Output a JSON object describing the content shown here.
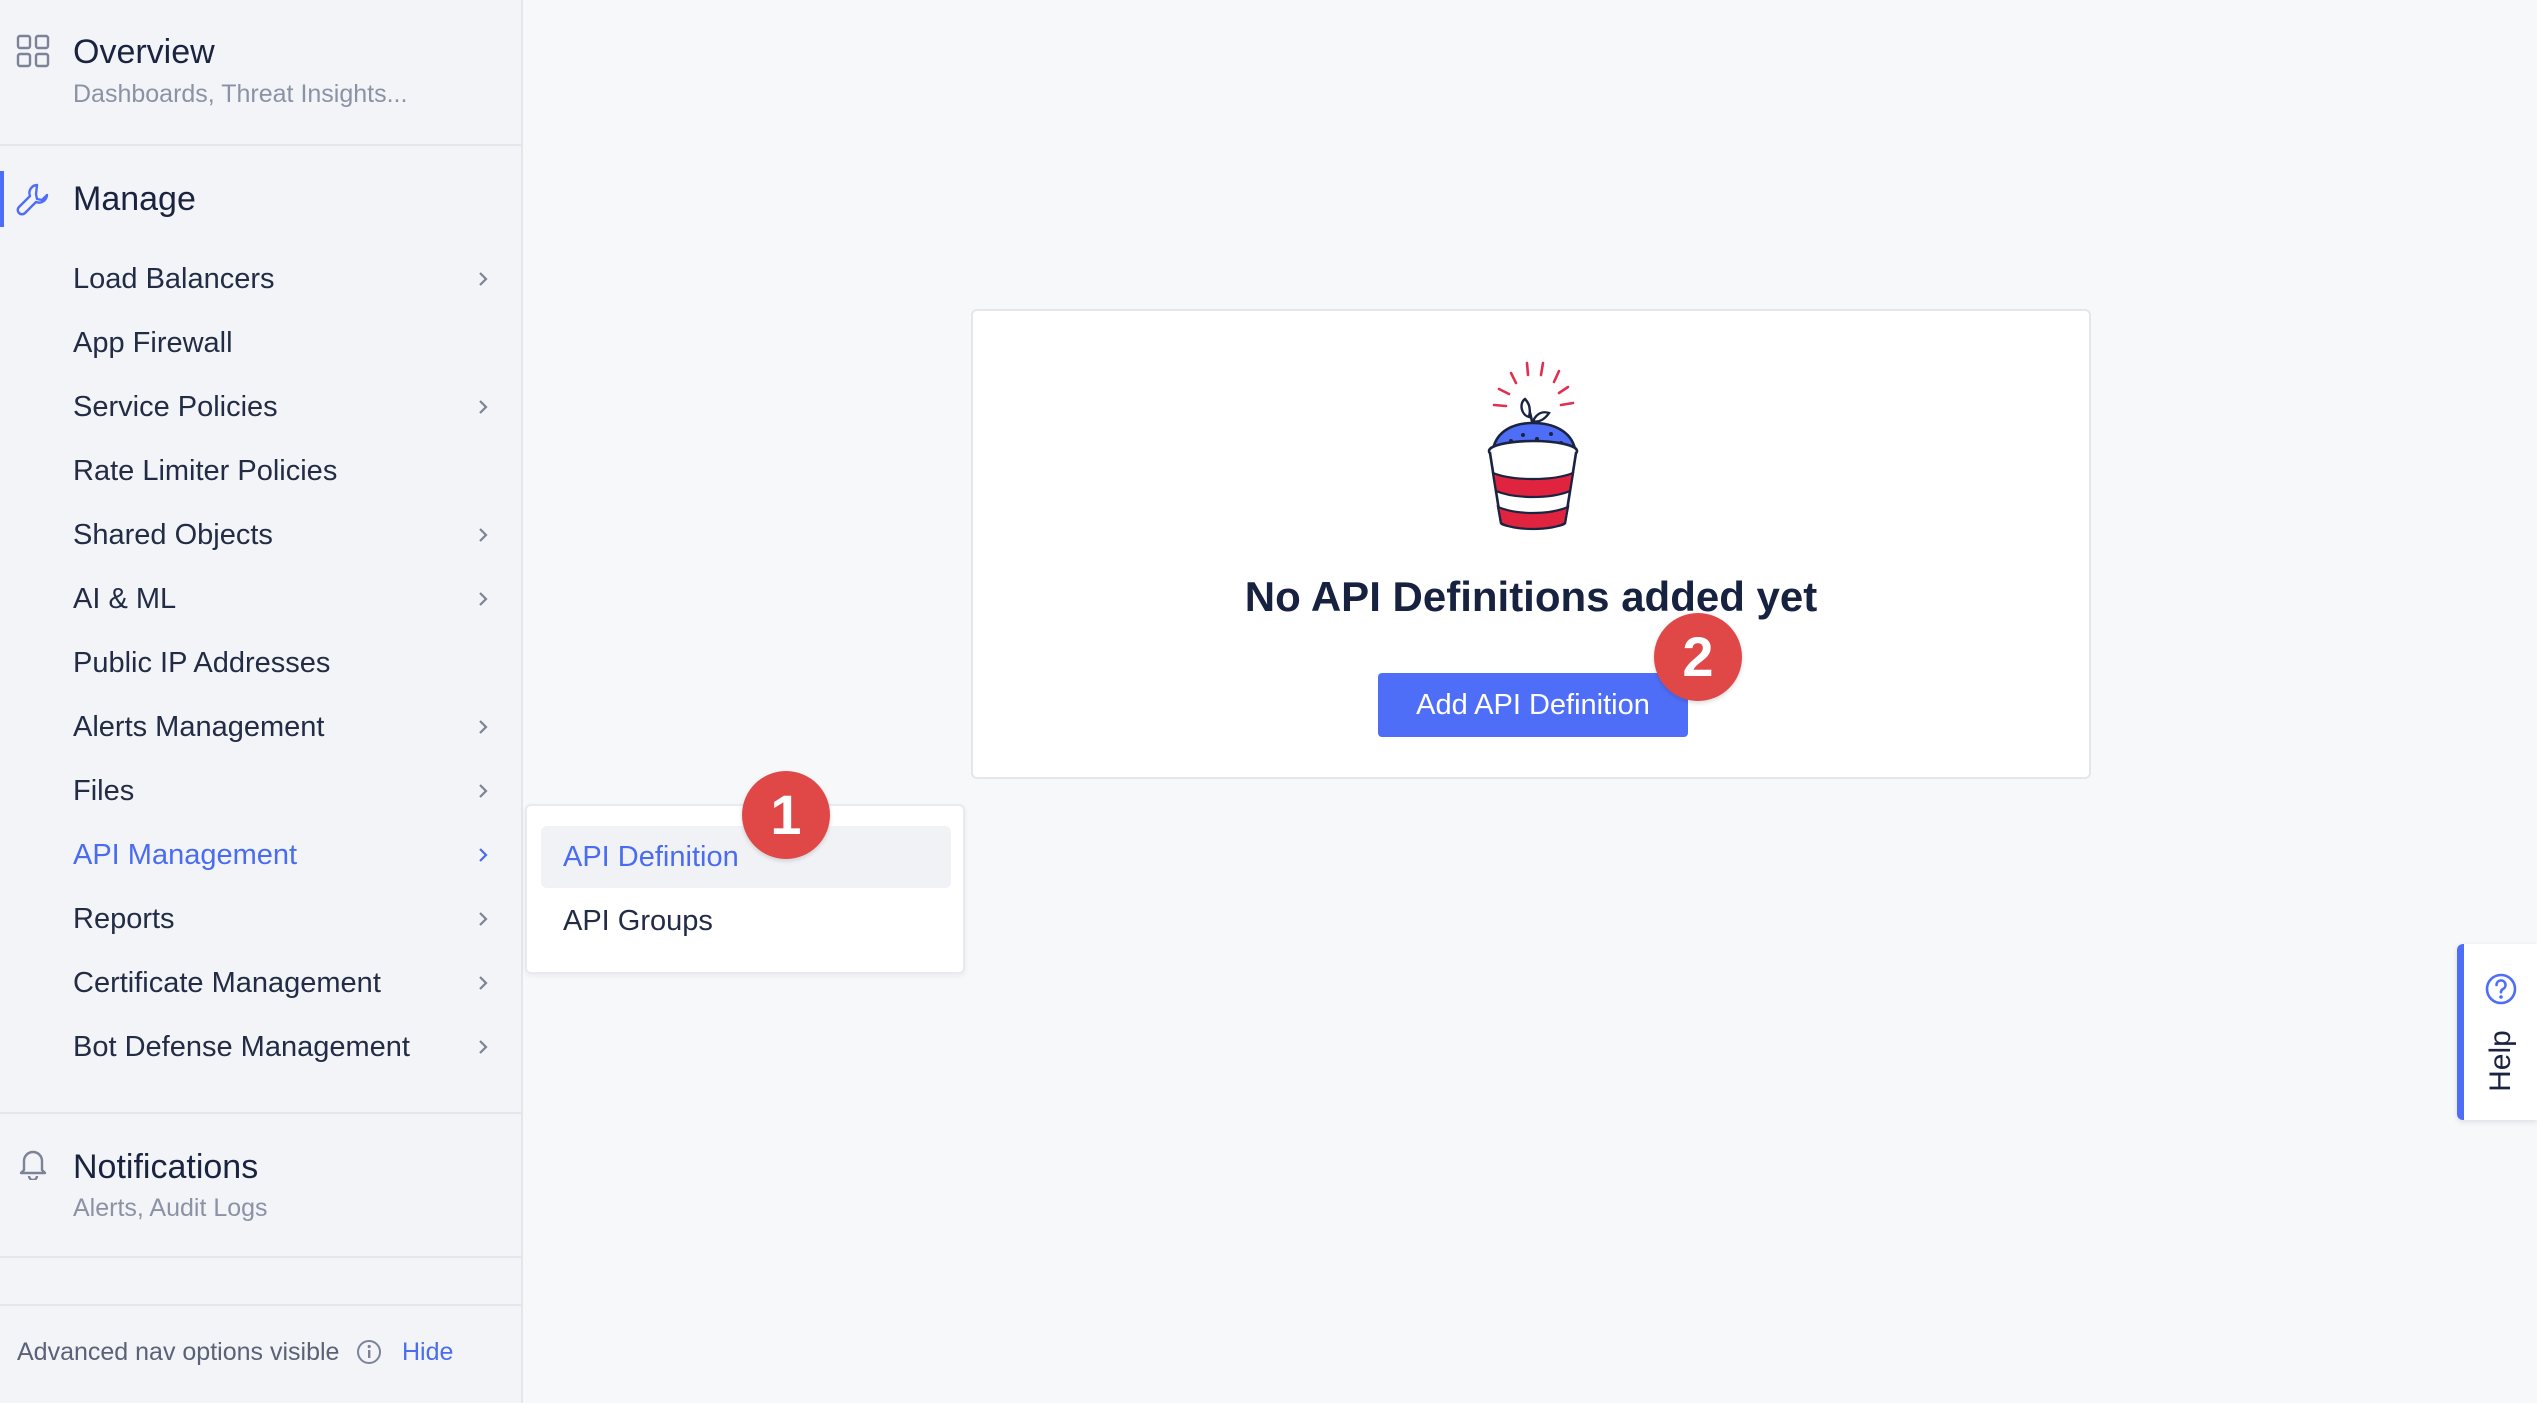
{
  "sidebar": {
    "overview": {
      "title": "Overview",
      "subtitle": "Dashboards, Threat Insights..."
    },
    "manage": {
      "title": "Manage",
      "items": [
        {
          "label": "Load Balancers",
          "has_children": true
        },
        {
          "label": "App Firewall",
          "has_children": false
        },
        {
          "label": "Service Policies",
          "has_children": true
        },
        {
          "label": "Rate Limiter Policies",
          "has_children": false
        },
        {
          "label": "Shared Objects",
          "has_children": true
        },
        {
          "label": "AI & ML",
          "has_children": true
        },
        {
          "label": "Public IP Addresses",
          "has_children": false
        },
        {
          "label": "Alerts Management",
          "has_children": true
        },
        {
          "label": "Files",
          "has_children": true
        },
        {
          "label": "API Management",
          "has_children": true,
          "active": true
        },
        {
          "label": "Reports",
          "has_children": true
        },
        {
          "label": "Certificate Management",
          "has_children": true
        },
        {
          "label": "Bot Defense Management",
          "has_children": true
        }
      ]
    },
    "notifications": {
      "title": "Notifications",
      "subtitle": "Alerts, Audit Logs"
    },
    "footer": {
      "text": "Advanced nav options visible",
      "hide_label": "Hide"
    }
  },
  "submenu": {
    "items": [
      {
        "label": "API Definition",
        "highlighted": true
      },
      {
        "label": "API Groups",
        "highlighted": false
      }
    ]
  },
  "main": {
    "empty_state": {
      "title": "No API Definitions added yet",
      "button_label": "Add API Definition",
      "illustration": "potted-sprout-illustration"
    }
  },
  "badges": [
    "1",
    "2"
  ],
  "help": {
    "label": "Help"
  },
  "colors": {
    "accent": "#4f6ef7",
    "badge": "#e04848",
    "sidebar_bg": "#f3f4f7",
    "page_bg": "#f7f8fa"
  }
}
